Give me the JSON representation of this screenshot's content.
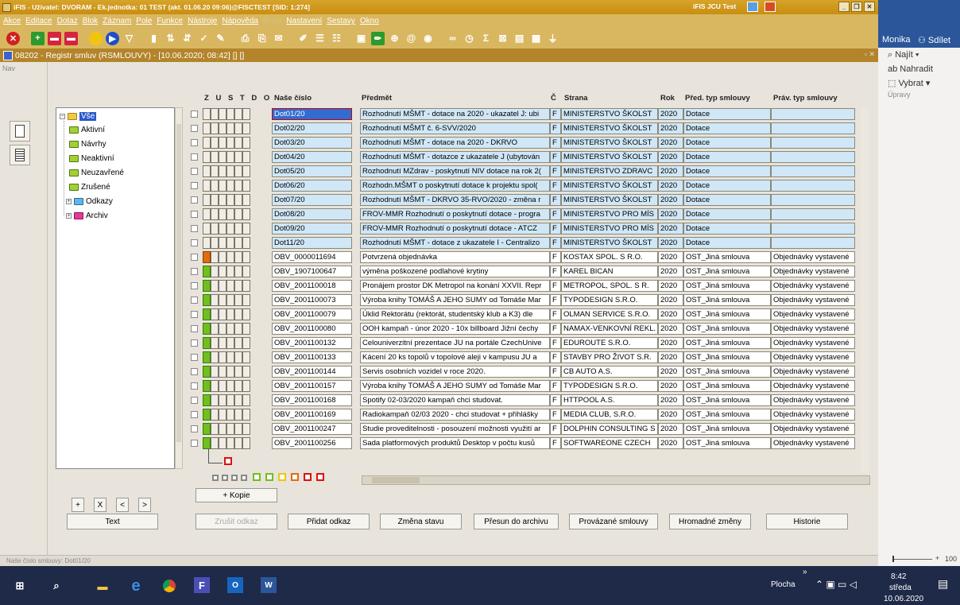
{
  "window": {
    "title": "iFIS - Uživatel: DVORAM - Ek.jednotka: 01 TEST (akt. 01.06.20 09:06)@FISCTEST  [SID: 1:274]",
    "center_title": "iFIS JCU Test"
  },
  "menu": [
    "Akce",
    "Editace",
    "Dotaz",
    "Blok",
    "Záznam",
    "Pole",
    "Funkce",
    "Nástroje",
    "Nápověda",
    "Entry",
    "Nastavení",
    "Sestavy",
    "Okno"
  ],
  "toolbar_icons": [
    "stop-icon",
    "save-icon",
    "delete-icon",
    "record-icon",
    "query-icon",
    "run-icon",
    "filter-icon",
    "chart-icon",
    "sort-asc-icon",
    "sort-desc-icon",
    "check-icon",
    "wand-icon",
    "print-icon",
    "print-preview-icon",
    "mail-icon",
    "edit-icon",
    "list-icon",
    "list2-icon",
    "calc-icon",
    "pen-icon",
    "globe-icon",
    "at-icon",
    "eye-icon",
    "link-icon",
    "clock-icon",
    "sum-icon",
    "excel-icon",
    "doc-icon",
    "calendar-icon",
    "tree-icon"
  ],
  "doc": {
    "title": "08202 - Registr smluv (RSMLOUVY) - [10.06.2020; 08:42] [] []"
  },
  "nav": {
    "label": "Nav"
  },
  "tree": {
    "items": [
      {
        "label": "Vše",
        "color": "#f3c844"
      },
      {
        "label": "Aktivní",
        "color": "#a4cf36"
      },
      {
        "label": "Návrhy",
        "color": "#a4cf36"
      },
      {
        "label": "Neaktivní",
        "color": "#a4cf36"
      },
      {
        "label": "Neuzavřené",
        "color": "#a4cf36"
      },
      {
        "label": "Zrušené",
        "color": "#a4cf36"
      },
      {
        "label": "Odkazy",
        "color": "#5fb6e6"
      },
      {
        "label": "Archiv",
        "color": "#e5389c"
      }
    ]
  },
  "tree_buttons": {
    "plus": "+",
    "x": "X",
    "prev": "<",
    "next": ">",
    "text": "Text"
  },
  "columns": {
    "flags": "Z U S T D O",
    "cislo": "Naše číslo",
    "predmet": "Předmět",
    "c": "Č",
    "strana": "Strana",
    "rok": "Rok",
    "pred_typ": "Před. typ smlouvy",
    "prav_typ": "Práv. typ smlouvy"
  },
  "rows": [
    {
      "cislo": "Dot01/20",
      "predmet": "Rozhodnutí MŠMT - dotace na 2020 - ukazatel J: ubi",
      "c": "F",
      "strana": "MINISTERSTVO ŠKOLST",
      "rok": "2020",
      "pred": "Dotace",
      "prav": "",
      "flag": "none",
      "blue": true
    },
    {
      "cislo": "Dot02/20",
      "predmet": "Rozhodnutí MŠMT č. 6-SVV/2020",
      "c": "F",
      "strana": "MINISTERSTVO ŠKOLST",
      "rok": "2020",
      "pred": "Dotace",
      "prav": "",
      "flag": "none",
      "blue": true
    },
    {
      "cislo": "Dot03/20",
      "predmet": "Rozhodnutí MŠMT - dotace na 2020 - DKRVO",
      "c": "F",
      "strana": "MINISTERSTVO ŠKOLST",
      "rok": "2020",
      "pred": "Dotace",
      "prav": "",
      "flag": "none",
      "blue": true
    },
    {
      "cislo": "Dot04/20",
      "predmet": "Rozhodnutí MŠMT - dotazce z ukazatele J (ubytován",
      "c": "F",
      "strana": "MINISTERSTVO ŠKOLST",
      "rok": "2020",
      "pred": "Dotace",
      "prav": "",
      "flag": "none",
      "blue": true
    },
    {
      "cislo": "Dot05/20",
      "predmet": "Rozhodnutí MZdrav - poskytnutí NIV dotace na rok 2(",
      "c": "F",
      "strana": "MINISTERSTVO ZDRAVC",
      "rok": "2020",
      "pred": "Dotace",
      "prav": "",
      "flag": "none",
      "blue": true
    },
    {
      "cislo": "Dot06/20",
      "predmet": "Rozhodn.MŠMT o poskytnutí dotace  k projektu spol(",
      "c": "F",
      "strana": "MINISTERSTVO ŠKOLST",
      "rok": "2020",
      "pred": "Dotace",
      "prav": "",
      "flag": "none",
      "blue": true
    },
    {
      "cislo": "Dot07/20",
      "predmet": "Rozhodnutí MŠMT - DKRVO 35-RVO/2020 - změna r",
      "c": "F",
      "strana": "MINISTERSTVO ŠKOLST",
      "rok": "2020",
      "pred": "Dotace",
      "prav": "",
      "flag": "none",
      "blue": true
    },
    {
      "cislo": "Dot08/20",
      "predmet": "FROV-MMR Rozhodnutí o poskytnutí dotace - progra",
      "c": "F",
      "strana": "MINISTERSTVO PRO MÍS",
      "rok": "2020",
      "pred": "Dotace",
      "prav": "",
      "flag": "none",
      "blue": true
    },
    {
      "cislo": "Dot09/20",
      "predmet": "FROV-MMR Rozhodnutí o poskytnutí dotace - ATCZ",
      "c": "F",
      "strana": "MINISTERSTVO PRO MÍS",
      "rok": "2020",
      "pred": "Dotace",
      "prav": "",
      "flag": "none",
      "blue": true
    },
    {
      "cislo": "Dot11/20",
      "predmet": "Rozhodnutí MŠMT - dotace z ukazatele I - Centralizo",
      "c": "F",
      "strana": "MINISTERSTVO ŠKOLST",
      "rok": "2020",
      "pred": "Dotace",
      "prav": "",
      "flag": "none",
      "blue": true
    },
    {
      "cislo": "OBV_0000011694",
      "predmet": "Potvrzená objednávka",
      "c": "F",
      "strana": "KOSTAX SPOL. S R.O.",
      "rok": "2020",
      "pred": "OST_Jiná smlouva",
      "prav": "Objednávky vystavené",
      "flag": "orange",
      "blue": false
    },
    {
      "cislo": "OBV_1907100647",
      "predmet": " výměna poškozené podlahové krytiny",
      "c": "F",
      "strana": "KAREL BICAN",
      "rok": "2020",
      "pred": "OST_Jiná smlouva",
      "prav": "Objednávky vystavené",
      "flag": "green",
      "blue": false
    },
    {
      "cislo": "OBV_2001100018",
      "predmet": "Pronájem prostor DK Metropol na konání XXVII. Repr",
      "c": "F",
      "strana": "METROPOL, SPOL. S R.",
      "rok": "2020",
      "pred": "OST_Jiná smlouva",
      "prav": "Objednávky vystavené",
      "flag": "green",
      "blue": false
    },
    {
      "cislo": "OBV_2001100073",
      "predmet": "Výroba knihy TOMÁŠ A JEHO SUMY od Tomáše Mar",
      "c": "F",
      "strana": "TYPODESIGN S.R.O.",
      "rok": "2020",
      "pred": "OST_Jiná smlouva",
      "prav": "Objednávky vystavené",
      "flag": "green",
      "blue": false
    },
    {
      "cislo": "OBV_2001100079",
      "predmet": "Úklid  Rektorátu (rektorát, studentský klub a K3) dle",
      "c": "F",
      "strana": "OLMAN SERVICE S.R.O.",
      "rok": "2020",
      "pred": "OST_Jiná smlouva",
      "prav": "Objednávky vystavené",
      "flag": "green",
      "blue": false
    },
    {
      "cislo": "OBV_2001100080",
      "predmet": "OOH kampaň - únor 2020 - 10x billboard Jižní čechy",
      "c": "F",
      "strana": "NAMAX-VENKOVNÍ REKL.",
      "rok": "2020",
      "pred": "OST_Jiná smlouva",
      "prav": "Objednávky vystavené",
      "flag": "green",
      "blue": false
    },
    {
      "cislo": "OBV_2001100132",
      "predmet": "Celouniverzitní prezentace JU na portále CzechUnive",
      "c": "F",
      "strana": "EDUROUTE S.R.O.",
      "rok": "2020",
      "pred": "OST_Jiná smlouva",
      "prav": "Objednávky vystavené",
      "flag": "green",
      "blue": false
    },
    {
      "cislo": "OBV_2001100133",
      "predmet": "Kácení 20 ks topolů v topolové aleji v kampusu JU a",
      "c": "F",
      "strana": "STAVBY PRO ŽIVOT S.R.",
      "rok": "2020",
      "pred": "OST_Jiná smlouva",
      "prav": "Objednávky vystavené",
      "flag": "green",
      "blue": false
    },
    {
      "cislo": "OBV_2001100144",
      "predmet": "Servis osobních vozidel v roce 2020.",
      "c": "F",
      "strana": "CB AUTO A.S.",
      "rok": "2020",
      "pred": "OST_Jiná smlouva",
      "prav": "Objednávky vystavené",
      "flag": "green",
      "blue": false
    },
    {
      "cislo": "OBV_2001100157",
      "predmet": "Výroba knihy TOMÁŠ A JEHO SUMY od Tomáše Mar",
      "c": "F",
      "strana": "TYPODESIGN S.R.O.",
      "rok": "2020",
      "pred": "OST_Jiná smlouva",
      "prav": "Objednávky vystavené",
      "flag": "green",
      "blue": false
    },
    {
      "cislo": "OBV_2001100168",
      "predmet": "Spotify 02-03/2020 kampaň chci studovat.",
      "c": "F",
      "strana": "HTTPOOL A.S.",
      "rok": "2020",
      "pred": "OST_Jiná smlouva",
      "prav": "Objednávky vystavené",
      "flag": "green",
      "blue": false
    },
    {
      "cislo": "OBV_2001100169",
      "predmet": "Radiokampaň 02/03 2020 - chci studovat + přihlášky",
      "c": "F",
      "strana": "MEDIA CLUB, S.R.O.",
      "rok": "2020",
      "pred": "OST_Jiná smlouva",
      "prav": "Objednávky vystavené",
      "flag": "green",
      "blue": false
    },
    {
      "cislo": "OBV_2001100247",
      "predmet": "Studie proveditelnosti - posouzení možnosti využití ar",
      "c": "F",
      "strana": "DOLPHIN CONSULTING S",
      "rok": "2020",
      "pred": "OST_Jiná smlouva",
      "prav": "Objednávky vystavené",
      "flag": "green",
      "blue": false
    },
    {
      "cislo": "OBV_2001100256",
      "predmet": "Sada platformových produktů Desktop v počtu kusů",
      "c": "F",
      "strana": "SOFTWAREONE CZECH",
      "rok": "2020",
      "pred": "OST_Jiná smlouva",
      "prav": "Objednávky vystavené",
      "flag": "green",
      "blue": false
    }
  ],
  "kopie_label": "+ Kopie",
  "buttons": {
    "zrusit": "Zrušit odkaz",
    "pridat": "Přidat odkaz",
    "zmena": "Změna stavu",
    "presun": "Přesun do archivu",
    "provazane": "Provázané smlouvy",
    "hromadne": "Hromadné změny",
    "historie": "Historie"
  },
  "status": "Naše číslo smlouvy: Dot01/20",
  "right_pane": {
    "user": "Monika",
    "share": "Sdílet",
    "find": "Najít",
    "replace": "Nahradit",
    "select": "Vybrat",
    "group": "Úpravy",
    "zoom": "100"
  },
  "taskbar": {
    "desktop": "Plocha",
    "time": "8:42",
    "day": "středa",
    "date": "10.06.2020"
  },
  "colors": {
    "titlebar": "#c88e10",
    "selection": "#2f6dd2",
    "taskbar": "#1f2a48",
    "word_blue": "#2b579a"
  }
}
